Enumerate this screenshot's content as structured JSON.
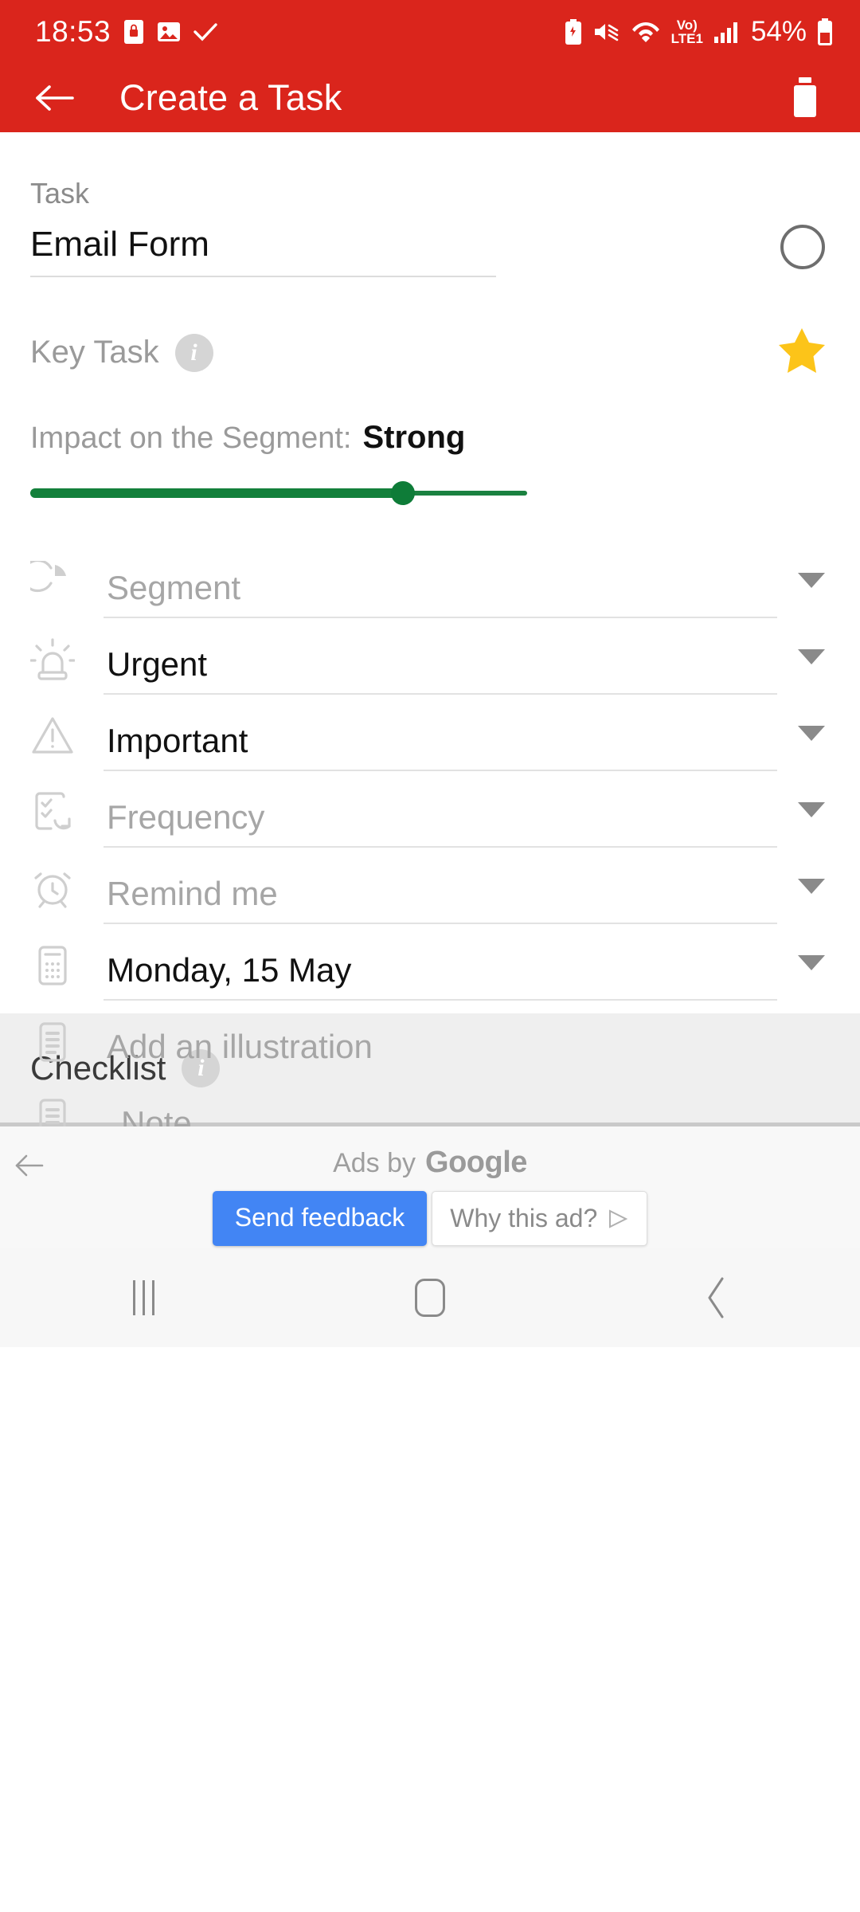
{
  "status_bar": {
    "time": "18:53",
    "battery_percent": "54%",
    "network_label": "LTE1",
    "volte_label": "Vo)",
    "icons": [
      "phone-lock-icon",
      "image-icon",
      "checkmark-icon",
      "battery-saver-icon",
      "mute-icon",
      "wifi-icon",
      "volte-icon",
      "signal-icon",
      "battery-icon"
    ]
  },
  "app_bar": {
    "title": "Create a Task",
    "back_icon": "arrow-left-icon",
    "delete_icon": "trash-icon"
  },
  "form": {
    "task_label": "Task",
    "task_value": "Email Form",
    "task_placeholder": "Task",
    "done_toggle_icon": "circle-outline-icon",
    "key_task_label": "Key Task",
    "key_task_info_icon": "info-icon",
    "star_icon": "star-filled-icon",
    "impact_label": "Impact on the Segment:",
    "impact_value": "Strong",
    "slider": {
      "value_percent": 75,
      "color": "#13803B"
    },
    "rows": [
      {
        "icon": "pie-chart-icon",
        "text": "Segment",
        "state": "placeholder",
        "caret": true,
        "underline": "light"
      },
      {
        "icon": "siren-icon",
        "text": "Urgent",
        "state": "filled",
        "caret": true,
        "underline": "light"
      },
      {
        "icon": "warning-triangle-icon",
        "text": "Important",
        "state": "filled",
        "caret": true,
        "underline": "light"
      },
      {
        "icon": "repeat-checklist-icon",
        "text": "Frequency",
        "state": "placeholder",
        "caret": true,
        "underline": "light"
      },
      {
        "icon": "alarm-clock-icon",
        "text": "Remind me",
        "state": "placeholder",
        "caret": true,
        "underline": "light"
      },
      {
        "icon": "calendar-icon",
        "text": "Monday, 15 May",
        "state": "filled",
        "caret": true,
        "underline": "light"
      },
      {
        "icon": "document-icon",
        "text": "Add an illustration",
        "state": "placeholder",
        "caret": false,
        "underline": "none"
      },
      {
        "icon": "note-icon",
        "text": "Note",
        "state": "placeholder",
        "caret": false,
        "underline": "dark"
      }
    ]
  },
  "checklist": {
    "label": "Checklist",
    "info_icon": "info-icon"
  },
  "ad": {
    "back_icon": "arrow-left-icon",
    "ads_by_text": "Ads by",
    "google_text": "Google",
    "send_feedback_label": "Send feedback",
    "why_this_ad_label": "Why this ad?",
    "why_this_ad_icon": "ad-choices-icon",
    "feedback_color": "#4285F4"
  },
  "nav_bar": {
    "recents_icon": "recents-icon",
    "home_icon": "home-icon",
    "back_icon": "back-chevron-icon"
  },
  "theme": {
    "accent_red": "#DA251C",
    "slider_green": "#13803B",
    "star_yellow": "#FCC419",
    "ad_blue": "#4285F4"
  }
}
